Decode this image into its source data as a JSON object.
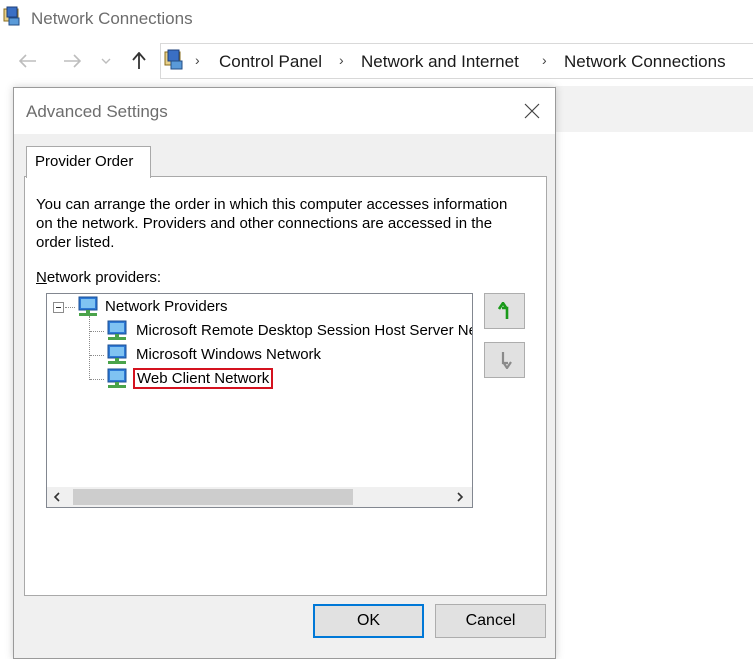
{
  "explorer": {
    "title": "Network Connections",
    "breadcrumbs": [
      "Control Panel",
      "Network and Internet",
      "Network Connections"
    ]
  },
  "dialog": {
    "title": "Advanced Settings",
    "tab_label": "Provider Order",
    "description": "You can arrange the order in which this computer accesses information on the network.  Providers and other connections are accessed in the order listed.",
    "providers_label_accel": "N",
    "providers_label_rest": "etwork providers:",
    "tree": {
      "root": "Network Providers",
      "children": [
        "Microsoft Remote Desktop Session Host Server Network",
        "Microsoft Windows Network",
        "Web Client Network"
      ],
      "selected_index": 2
    },
    "buttons": {
      "ok": "OK",
      "cancel": "Cancel"
    }
  },
  "colors": {
    "highlight_border": "#d4121f",
    "move_up_arrow": "#1a9a1a",
    "default_button_border": "#0078d7"
  }
}
